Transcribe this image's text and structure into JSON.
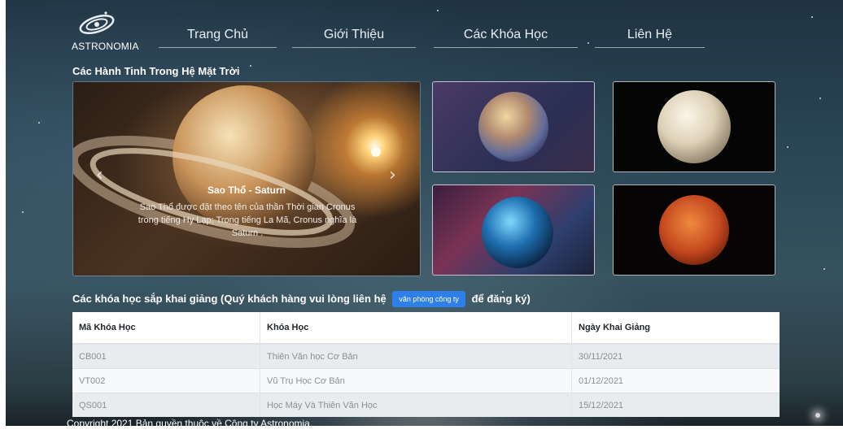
{
  "brand": {
    "name": "ASTRONOMIA"
  },
  "nav": {
    "items": [
      "Trang Chủ",
      "Giới Thiệu",
      "Các Khóa Học",
      "Liên Hệ"
    ]
  },
  "planets_section": {
    "title": "Các Hành Tinh Trong Hệ Mặt Trời"
  },
  "carousel": {
    "slide_title": "Sao Thổ - Saturn",
    "slide_text": "Sao Thổ được đặt theo tên của thần Thời gian Cronus trong tiếng Hy Lạp; Trong tiếng La Mã, Cronus nghĩa là Saturn ."
  },
  "courses": {
    "intro_prefix": "Các khóa học sắp khai giảng (Quý khách hàng vui lòng liên hệ",
    "contact_button": "văn phòng công ty",
    "intro_suffix": "để đăng ký)",
    "headers": [
      "Mã Khóa Học",
      "Khóa Học",
      "Ngày Khai Giảng"
    ],
    "rows": [
      [
        "CB001",
        "Thiên Văn học Cơ Bản",
        "30/11/2021"
      ],
      [
        "VT002",
        "Vũ Trụ Học Cơ Bản",
        "01/12/2021"
      ],
      [
        "QS001",
        "Học Máy Và Thiên Văn Học",
        "15/12/2021"
      ]
    ]
  },
  "footer": {
    "copyright": "Copyright 2021 Bản quyền thuộc về Công ty Astronomia."
  }
}
